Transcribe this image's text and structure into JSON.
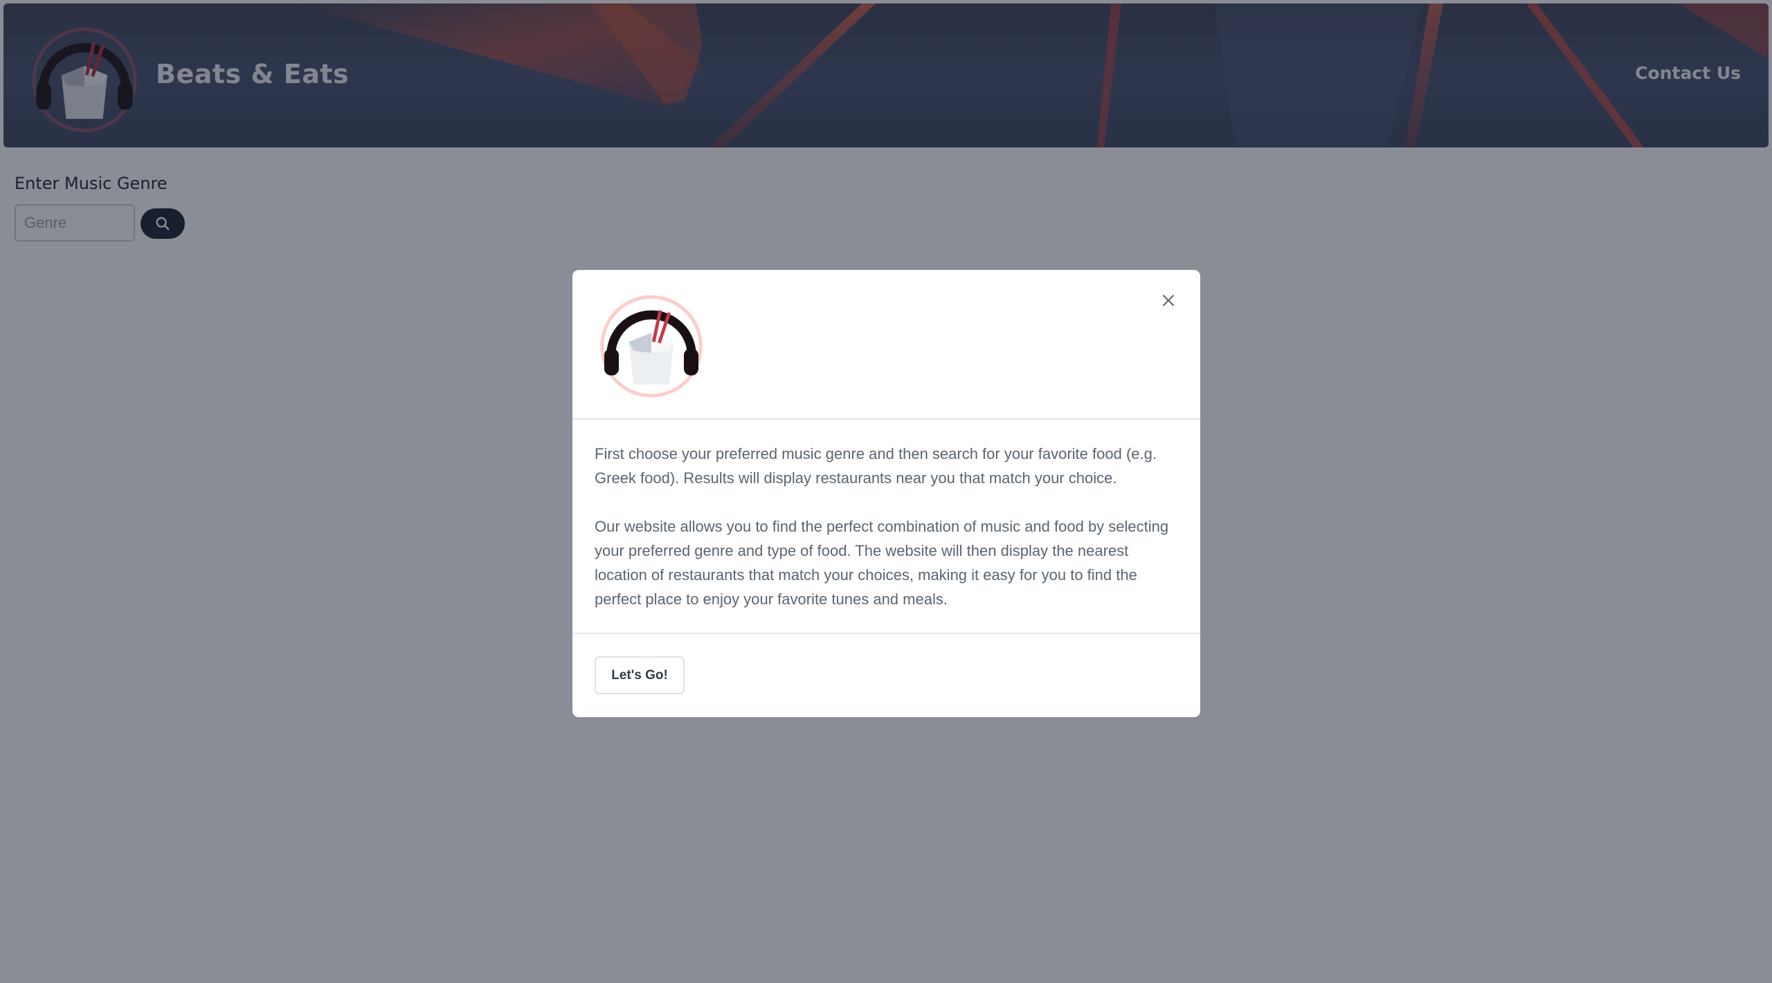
{
  "header": {
    "brand_name": "Beats & Eats",
    "contact_link": "Contact Us"
  },
  "search": {
    "label": "Enter Music Genre",
    "placeholder": "Genre",
    "value": ""
  },
  "modal": {
    "paragraphs": [
      "First choose your preferred music genre and then search for your favorite food (e.g. Greek food). Results will display restaurants near you that match your choice.",
      "Our website allows you to find the perfect combination of music and food by selecting your preferred genre and type of food. The website will then display the nearest location of restaurants that match your choices, making it easy for you to find the perfect place to enjoy your favorite tunes and meals."
    ],
    "primary_button": "Let's Go!"
  },
  "icons": {
    "logo": "headphones-takeout-box-logo",
    "search": "search-icon",
    "close": "close-icon"
  },
  "colors": {
    "header_bg": "#3d4660",
    "accent_red": "#e0443a",
    "search_button": "#1b2230",
    "backdrop": "rgba(21,27,43,0.5)"
  }
}
